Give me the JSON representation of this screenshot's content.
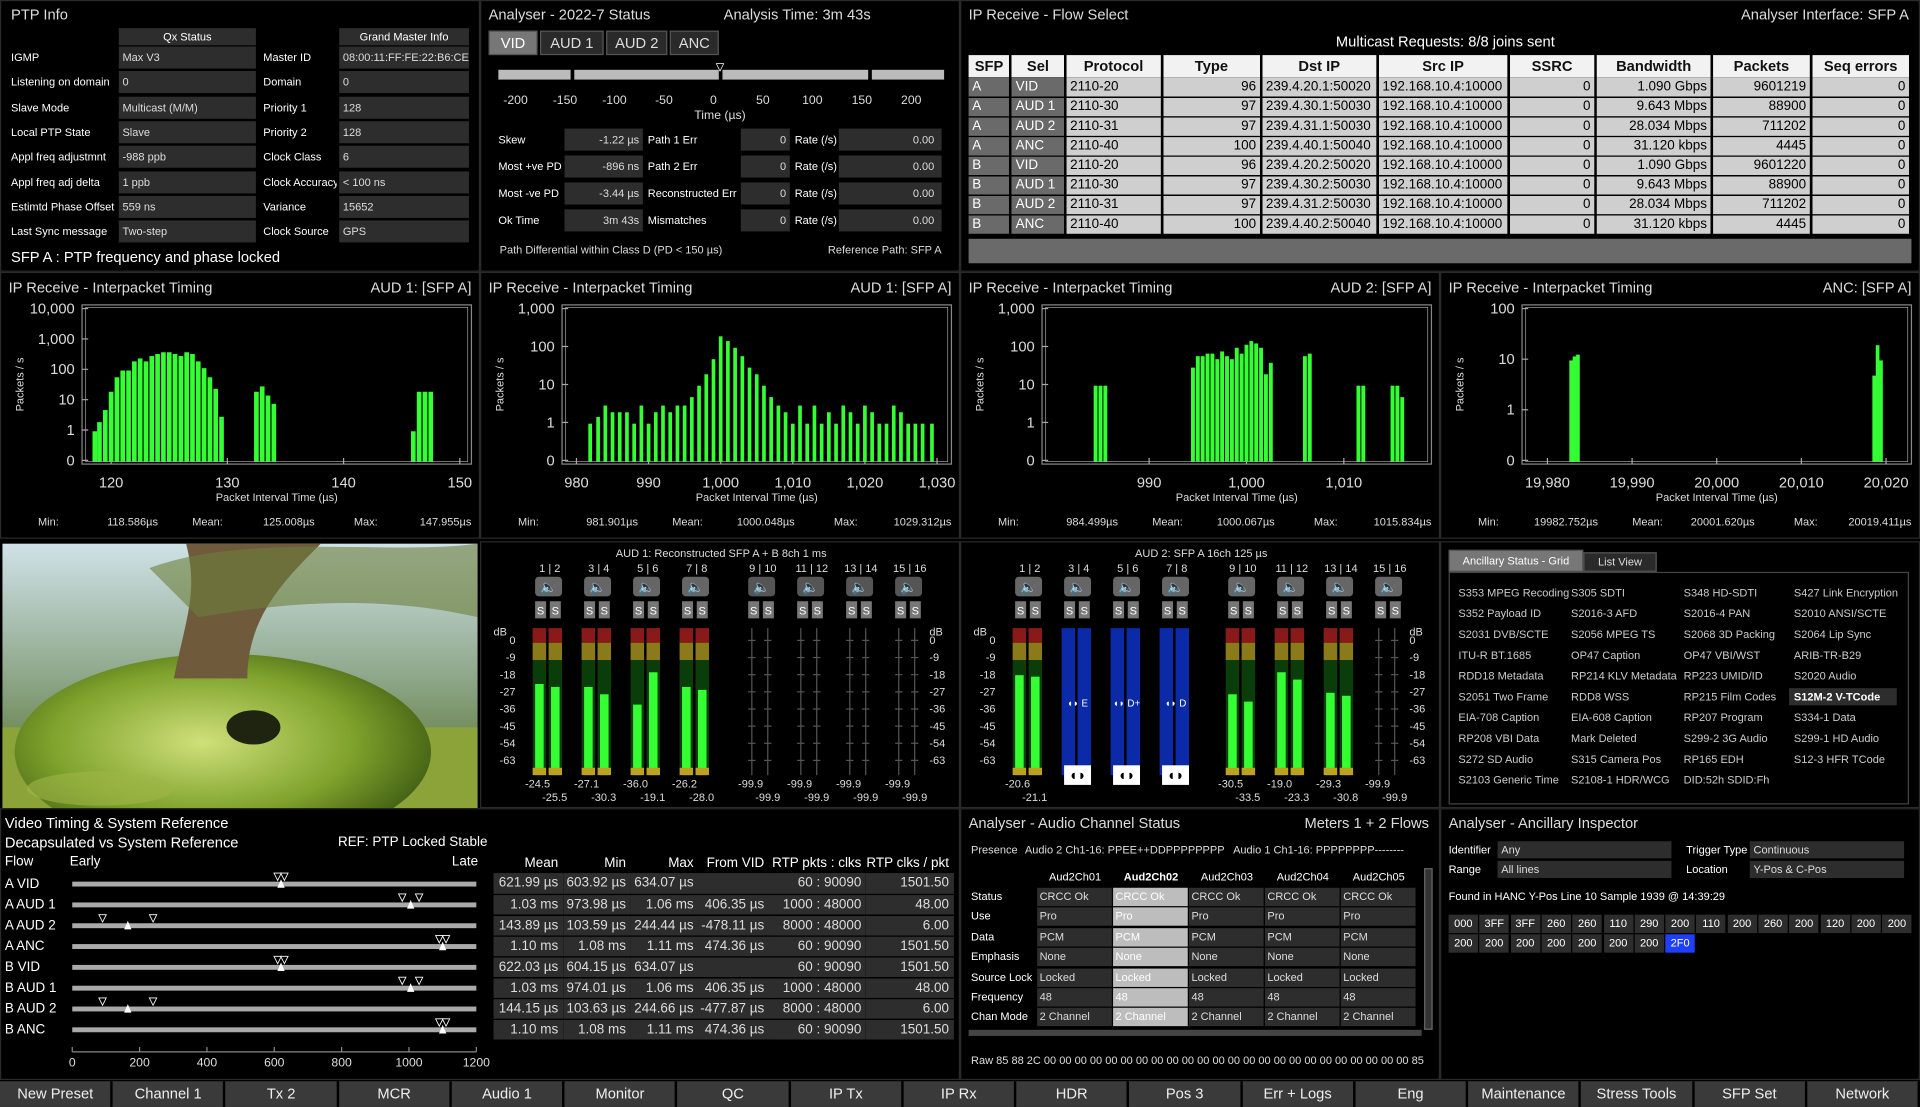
{
  "ptp": {
    "title": "PTP Info",
    "col1_header": "Qx Status",
    "col2_header": "Grand Master Info",
    "left": [
      {
        "k": "IGMP",
        "v": "Max V3"
      },
      {
        "k": "Listening on domain",
        "v": "0"
      },
      {
        "k": "Slave Mode",
        "v": "Multicast (M/M)"
      },
      {
        "k": "Local PTP State",
        "v": "Slave"
      },
      {
        "k": "Appl freq adjustmnt",
        "v": "-988 ppb"
      },
      {
        "k": "Appl freq adj delta",
        "v": "1 ppb"
      },
      {
        "k": "Estimtd Phase Offset",
        "v": "559 ns"
      },
      {
        "k": "Last Sync message",
        "v": "Two-step"
      }
    ],
    "right": [
      {
        "k": "Master ID",
        "v": "08:00:11:FF:FE:22:B6:CE"
      },
      {
        "k": "Domain",
        "v": "0"
      },
      {
        "k": "Priority 1",
        "v": "128"
      },
      {
        "k": "Priority 2",
        "v": "128"
      },
      {
        "k": "Clock Class",
        "v": "6"
      },
      {
        "k": "Clock Accuracy",
        "v": "< 100 ns"
      },
      {
        "k": "Variance",
        "v": "15652"
      },
      {
        "k": "Clock Source",
        "v": "GPS"
      }
    ],
    "status": "SFP A :  PTP frequency and phase locked"
  },
  "analyser": {
    "title": "Analyser - 2022-7 Status",
    "time": "Analysis Time: 3m 43s",
    "tabs": [
      "VID",
      "AUD 1",
      "AUD 2",
      "ANC"
    ],
    "axis_ticks": [
      "-200",
      "-150",
      "-100",
      "-50",
      "0",
      "50",
      "100",
      "150",
      "200"
    ],
    "axis_label": "Time (µs)",
    "rows": [
      {
        "a": "Skew",
        "b": "-1.22 µs",
        "c": "Path 1 Err",
        "d": "0",
        "e": "Rate (/s)",
        "f": "0.00"
      },
      {
        "a": "Most +ve PD",
        "b": "-896 ns",
        "c": "Path 2 Err",
        "d": "0",
        "e": "Rate (/s)",
        "f": "0.00"
      },
      {
        "a": "Most -ve PD",
        "b": "-3.44 µs",
        "c": "Reconstructed Err",
        "d": "0",
        "e": "Rate (/s)",
        "f": "0.00"
      },
      {
        "a": "Ok Time",
        "b": "3m 43s",
        "c": "Mismatches",
        "d": "0",
        "e": "Rate (/s)",
        "f": "0.00"
      }
    ],
    "footer_left": "Path Differential within Class D (PD < 150 µs)",
    "footer_right": "Reference Path: SFP A"
  },
  "flow": {
    "title": "IP Receive - Flow Select",
    "interface": "Analyser Interface: SFP A",
    "requests": "Multicast Requests: 8/8 joins sent",
    "headers": [
      "SFP",
      "Sel",
      "Protocol",
      "Type",
      "Dst IP",
      "Src IP",
      "SSRC",
      "Bandwidth",
      "Packets",
      "Seq errors"
    ],
    "rows": [
      [
        "A",
        "VID",
        "2110-20",
        "96",
        "239.4.20.1:50020",
        "192.168.10.4:10000",
        "0",
        "1.090 Gbps",
        "9601219",
        "0"
      ],
      [
        "A",
        "AUD 1",
        "2110-30",
        "97",
        "239.4.30.1:50030",
        "192.168.10.4:10000",
        "0",
        "9.643 Mbps",
        "88900",
        "0"
      ],
      [
        "A",
        "AUD 2",
        "2110-31",
        "97",
        "239.4.31.1:50030",
        "192.168.10.4:10000",
        "0",
        "28.034 Mbps",
        "711202",
        "0"
      ],
      [
        "A",
        "ANC",
        "2110-40",
        "100",
        "239.4.40.1:50040",
        "192.168.10.4:10000",
        "0",
        "31.120 kbps",
        "4445",
        "0"
      ],
      [
        "B",
        "VID",
        "2110-20",
        "96",
        "239.4.20.2:50020",
        "192.168.10.4:10000",
        "0",
        "1.090 Gbps",
        "9601220",
        "0"
      ],
      [
        "B",
        "AUD 1",
        "2110-30",
        "97",
        "239.4.30.2:50030",
        "192.168.10.4:10000",
        "0",
        "9.643 Mbps",
        "88900",
        "0"
      ],
      [
        "B",
        "AUD 2",
        "2110-31",
        "97",
        "239.4.31.2:50030",
        "192.168.10.4:10000",
        "0",
        "28.034 Mbps",
        "711202",
        "0"
      ],
      [
        "B",
        "ANC",
        "2110-40",
        "100",
        "239.4.40.2:50040",
        "192.168.10.4:10000",
        "0",
        "31.120 kbps",
        "4445",
        "0"
      ]
    ]
  },
  "chart_data": [
    {
      "type": "bar",
      "title": "IP Receive - Interpacket Timing",
      "subtitle": "AUD 1: [SFP A]",
      "xlabel": "Packet Interval Time (µs)",
      "ylabel": "Packets / s",
      "log": true,
      "yticks": [
        "10,000",
        "1,000",
        "100",
        "10",
        "1",
        "0"
      ],
      "xticks": [
        "120",
        "130",
        "140",
        "150"
      ],
      "xlim": [
        117.5,
        151
      ],
      "ylim": [
        0,
        10000
      ],
      "x": [
        118.6,
        119,
        119.5,
        120,
        120.5,
        121,
        121.5,
        122,
        122.5,
        123,
        123.5,
        124,
        124.5,
        125,
        125.5,
        126,
        126.5,
        127,
        127.5,
        128,
        128.5,
        129,
        129.5,
        132.5,
        133,
        133.5,
        134,
        146,
        146.5,
        147,
        147.5
      ],
      "values": [
        1,
        2,
        5,
        20,
        60,
        100,
        100,
        200,
        250,
        200,
        300,
        350,
        400,
        400,
        350,
        300,
        400,
        350,
        200,
        120,
        60,
        25,
        3,
        20,
        30,
        15,
        8,
        1,
        20,
        20,
        20
      ],
      "min": "118.586µs",
      "mean": "125.008µs",
      "max": "147.955µs"
    },
    {
      "type": "bar",
      "title": "IP Receive - Interpacket Timing",
      "subtitle": "AUD 1: [SFP A]",
      "xlabel": "Packet Interval Time (µs)",
      "ylabel": "Packets / s",
      "log": true,
      "yticks": [
        "1,000",
        "100",
        "10",
        "1",
        "0"
      ],
      "xticks": [
        "980",
        "990",
        "1,000",
        "1,010",
        "1,020",
        "1,030"
      ],
      "xlim": [
        978,
        1032
      ],
      "x": [
        981.9,
        983,
        984,
        985,
        986,
        987,
        988,
        989,
        990,
        991,
        992,
        993,
        994,
        995,
        996,
        997,
        998,
        999,
        1000,
        1001,
        1002,
        1003,
        1004,
        1005,
        1006,
        1007,
        1008,
        1009,
        1010,
        1011,
        1012,
        1013,
        1014,
        1015,
        1016,
        1017,
        1018,
        1019,
        1020,
        1021,
        1022,
        1023,
        1024,
        1025,
        1026,
        1027,
        1028,
        1029.3
      ],
      "values": [
        1,
        1.5,
        3,
        2,
        2,
        2,
        1,
        3,
        1,
        2,
        3,
        2,
        3,
        3,
        5,
        10,
        20,
        50,
        200,
        150,
        100,
        60,
        30,
        20,
        10,
        5,
        3,
        2,
        1,
        3,
        1,
        3,
        1,
        2,
        1,
        3,
        2,
        1,
        3,
        2,
        1,
        1,
        3,
        2,
        1,
        1,
        1,
        1
      ],
      "min": "981.901µs",
      "mean": "1000.048µs",
      "max": "1029.312µs"
    },
    {
      "type": "bar",
      "title": "IP Receive - Interpacket Timing",
      "subtitle": "AUD 2: [SFP A]",
      "xlabel": "Packet Interval Time (µs)",
      "ylabel": "Packets / s",
      "log": true,
      "yticks": [
        "1,000",
        "100",
        "10",
        "1",
        "0"
      ],
      "xticks": [
        "990",
        "1,000",
        "1,010"
      ],
      "xlim": [
        979,
        1019
      ],
      "x": [
        984.5,
        985,
        985.5,
        994.5,
        995,
        995.5,
        996,
        996.5,
        997,
        997.5,
        998,
        998.5,
        999,
        999.5,
        1000,
        1000.5,
        1001,
        1001.5,
        1002,
        1002.5,
        1006,
        1006.5,
        1011.5,
        1012,
        1015,
        1015.5,
        1016
      ],
      "values": [
        10,
        10,
        10,
        30,
        60,
        60,
        70,
        70,
        50,
        80,
        60,
        50,
        100,
        70,
        120,
        150,
        130,
        100,
        20,
        40,
        60,
        70,
        10,
        10,
        10,
        10,
        5
      ],
      "min": "984.499µs",
      "mean": "1000.067µs",
      "max": "1015.834µs"
    },
    {
      "type": "bar",
      "title": "IP Receive - Interpacket Timing",
      "subtitle": "ANC: [SFP A]",
      "xlabel": "Packet Interval Time (µs)",
      "ylabel": "Packets / s",
      "log": true,
      "yticks": [
        "100",
        "10",
        "1",
        "0"
      ],
      "xticks": [
        "19,980",
        "19,990",
        "20,000",
        "20,010",
        "20,020"
      ],
      "xlim": [
        19977,
        20023
      ],
      "x": [
        19982.8,
        19983.2,
        19983.6,
        20018.6,
        20019,
        20019.4
      ],
      "values": [
        10,
        12,
        13,
        5,
        20,
        10
      ],
      "min": "19982.752µs",
      "mean": "20001.620µs",
      "max": "20019.411µs"
    }
  ],
  "aud1": {
    "title": "AUD 1: Reconstructed SFP A + B 8ch 1 ms",
    "channels": [
      "1 | 2",
      "3 | 4",
      "5 | 6",
      "7 | 8",
      "9 | 10",
      "11 | 12",
      "13 | 14",
      "15 | 16"
    ],
    "db": [
      "0",
      "-9",
      "-18",
      "-27",
      "-36",
      "-45",
      "-54",
      "-63"
    ],
    "db_label": "dB",
    "levels": [
      {
        "a": "-24.5",
        "b": "-25.5",
        "la": 0.62,
        "lb": 0.6
      },
      {
        "a": "-27.1",
        "b": "-30.3",
        "la": 0.6,
        "lb": 0.55
      },
      {
        "a": "-36.0",
        "b": "-19.1",
        "la": 0.48,
        "lb": 0.7
      },
      {
        "a": "-26.2",
        "b": "-28.0",
        "la": 0.6,
        "lb": 0.58
      },
      {
        "a": "-99.9",
        "b": "-99.9",
        "la": 0,
        "lb": 0
      },
      {
        "a": "-99.9",
        "b": "-99.9",
        "la": 0,
        "lb": 0
      },
      {
        "a": "-99.9",
        "b": "-99.9",
        "la": 0,
        "lb": 0
      },
      {
        "a": "-99.9",
        "b": "-99.9",
        "la": 0,
        "lb": 0
      }
    ]
  },
  "aud2": {
    "title": "AUD 2: SFP A 16ch 125 µs",
    "channels": [
      "1 | 2",
      "3 | 4",
      "5 | 6",
      "7 | 8",
      "9 | 10",
      "11 | 12",
      "13 | 14",
      "15 | 16"
    ],
    "db": [
      "0",
      "-9",
      "-18",
      "-27",
      "-36",
      "-45",
      "-54",
      "-63"
    ],
    "db_label": "dB",
    "levels": [
      {
        "a": "-20.6",
        "b": "-21.1",
        "la": 0.68,
        "lb": 0.67
      },
      {
        "a": "",
        "b": "",
        "la": 0,
        "lb": 0
      },
      {
        "a": "",
        "b": "",
        "la": 0,
        "lb": 0
      },
      {
        "a": "",
        "b": "",
        "la": 0,
        "lb": 0
      },
      {
        "a": "-30.5",
        "b": "-33.5",
        "la": 0.55,
        "lb": 0.5
      },
      {
        "a": "-19.0",
        "b": "-23.3",
        "la": 0.7,
        "lb": 0.65
      },
      {
        "a": "-29.3",
        "b": "-30.8",
        "la": 0.56,
        "lb": 0.54
      },
      {
        "a": "-99.9",
        "b": "-99.9",
        "la": 0,
        "lb": 0
      }
    ],
    "dolby": [
      "E",
      "D+",
      "D"
    ]
  },
  "anc": {
    "tabs": [
      "Ancillary Status - Grid",
      "List View"
    ],
    "items": [
      [
        "S353 MPEG Recoding",
        "S305 SDTI",
        "S348 HD-SDTI",
        "S427 Link Encryption"
      ],
      [
        "S352 Payload ID",
        "S2016-3 AFD",
        "S2016-4 PAN",
        "S2010 ANSI/SCTE"
      ],
      [
        "S2031 DVB/SCTE",
        "S2056 MPEG TS",
        "S2068 3D Packing",
        "S2064 Lip Sync"
      ],
      [
        "ITU-R BT.1685",
        "OP47 Caption",
        "OP47 VBI/WST",
        "ARIB-TR-B29"
      ],
      [
        "RDD18 Metadata",
        "RP214 KLV Metadata",
        "RP223 UMID/ID",
        "S2020 Audio"
      ],
      [
        "S2051 Two Frame",
        "RDD8 WSS",
        "RP215 Film Codes",
        "S12M-2 V-TCode"
      ],
      [
        "EIA-708 Caption",
        "EIA-608 Caption",
        "RP207 Program",
        "S334-1 Data"
      ],
      [
        "RP208 VBI Data",
        "Mark Deleted",
        "S299-2 3G Audio",
        "S299-1 HD Audio"
      ],
      [
        "S272 SD Audio",
        "S315 Camera Pos",
        "RP165 EDH",
        "S12-3 HFR TCode"
      ],
      [
        "S2103 Generic Time",
        "S2108-1 HDR/WCG",
        "DID:52h SDID:Fh",
        ""
      ]
    ]
  },
  "vtiming": {
    "title1": "Video Timing & System Reference",
    "title2": "Decapsulated vs System Reference",
    "ref": "REF: PTP  Locked Stable",
    "col_flow": "Flow",
    "early": "Early",
    "late": "Late",
    "flows": [
      "A VID",
      "A AUD 1",
      "A AUD 2",
      "A ANC",
      "B VID",
      "B AUD 1",
      "B AUD 2",
      "B ANC"
    ],
    "xticks": [
      "0",
      "200",
      "400",
      "600",
      "800",
      "1000",
      "1200"
    ],
    "markers": [
      [
        610,
        630
      ],
      [
        980,
        1030
      ],
      [
        90,
        240
      ],
      [
        1090,
        1110
      ],
      [
        610,
        630
      ],
      [
        980,
        1030
      ],
      [
        90,
        240
      ],
      [
        1090,
        1110
      ]
    ],
    "headers": [
      "Mean",
      "Min",
      "Max",
      "From VID",
      "RTP pkts : clks",
      "RTP clks / pkt"
    ],
    "rows": [
      [
        "621.99 µs",
        "603.92 µs",
        "634.07 µs",
        "",
        "60 : 90090",
        "1501.50"
      ],
      [
        "1.03 ms",
        "973.98 µs",
        "1.06 ms",
        "406.35 µs",
        "1000 : 48000",
        "48.00"
      ],
      [
        "143.89 µs",
        "103.59 µs",
        "244.44 µs",
        "-478.11 µs",
        "8000 : 48000",
        "6.00"
      ],
      [
        "1.10 ms",
        "1.08 ms",
        "1.11 ms",
        "474.36 µs",
        "60 : 90090",
        "1501.50"
      ],
      [
        "622.03 µs",
        "604.15 µs",
        "634.07 µs",
        "",
        "60 : 90090",
        "1501.50"
      ],
      [
        "1.03 ms",
        "974.01 µs",
        "1.06 ms",
        "406.35 µs",
        "1000 : 48000",
        "48.00"
      ],
      [
        "144.15 µs",
        "103.63 µs",
        "244.66 µs",
        "-477.87 µs",
        "8000 : 48000",
        "6.00"
      ],
      [
        "1.10 ms",
        "1.08 ms",
        "1.11 ms",
        "474.36 µs",
        "60 : 90090",
        "1501.50"
      ]
    ]
  },
  "audch": {
    "title": "Analyser - Audio Channel Status",
    "meters": "Meters 1 + 2 Flows",
    "presence_label": "Presence",
    "presence_a2": "Audio 2 Ch1-16: PPEE++DDPPPPPPPP",
    "presence_a1": "Audio 1 Ch1-16: PPPPPPPP--------",
    "cols": [
      "Aud2Ch01",
      "Aud2Ch02",
      "Aud2Ch03",
      "Aud2Ch04",
      "Aud2Ch05"
    ],
    "rows": [
      {
        "k": "Status",
        "v": [
          "CRCC Ok",
          "CRCC Ok",
          "CRCC Ok",
          "CRCC Ok",
          "CRCC Ok"
        ]
      },
      {
        "k": "Use",
        "v": [
          "Pro",
          "Pro",
          "Pro",
          "Pro",
          "Pro"
        ]
      },
      {
        "k": "Data",
        "v": [
          "PCM",
          "PCM",
          "PCM",
          "PCM",
          "PCM"
        ]
      },
      {
        "k": "Emphasis",
        "v": [
          "None",
          "None",
          "None",
          "None",
          "None"
        ]
      },
      {
        "k": "Source Lock",
        "v": [
          "Locked",
          "Locked",
          "Locked",
          "Locked",
          "Locked"
        ]
      },
      {
        "k": "Frequency",
        "v": [
          "48",
          "48",
          "48",
          "48",
          "48"
        ]
      },
      {
        "k": "Chan Mode",
        "v": [
          "2 Channel",
          "2 Channel",
          "2 Channel",
          "2 Channel",
          "2 Channel"
        ]
      }
    ],
    "raw": "Raw  85 88 2C 00      00 00 00 00      00 00 00 00      00 00 00 00      00 00 00 00      00 00 00 00      00 00 00 85"
  },
  "ancinsp": {
    "title": "Analyser - Ancillary Inspector",
    "identifier_label": "Identifier",
    "identifier": "Any",
    "trigger_label": "Trigger Type",
    "trigger": "Continuous",
    "range_label": "Range",
    "range": "All lines",
    "location_label": "Location",
    "location": "Y-Pos & C-Pos",
    "found": "Found in  HANC Y-Pos Line 10 Sample 1939 @ 14:39:29",
    "row1": [
      "000",
      "3FF",
      "3FF",
      "260",
      "260",
      "110",
      "290",
      "200",
      "110",
      "200",
      "260",
      "200",
      "120",
      "200",
      "200"
    ],
    "row2": [
      "200",
      "200",
      "200",
      "200",
      "200",
      "200",
      "200",
      "2F0"
    ]
  },
  "bottom": [
    "New Preset",
    "Channel 1",
    "Tx 2",
    "MCR",
    "Audio 1",
    "Monitor",
    "QC",
    "IP Tx",
    "IP Rx",
    "HDR",
    "Pos 3",
    "Err + Logs",
    "Eng",
    "Maintenance",
    "Stress Tools",
    "SFP Set",
    "Network"
  ],
  "colors": {
    "green": "#33ff33",
    "panel": "#2d2d2d",
    "selected_blue": "#1f3fff",
    "meter_blue": "#0a2aa8"
  }
}
